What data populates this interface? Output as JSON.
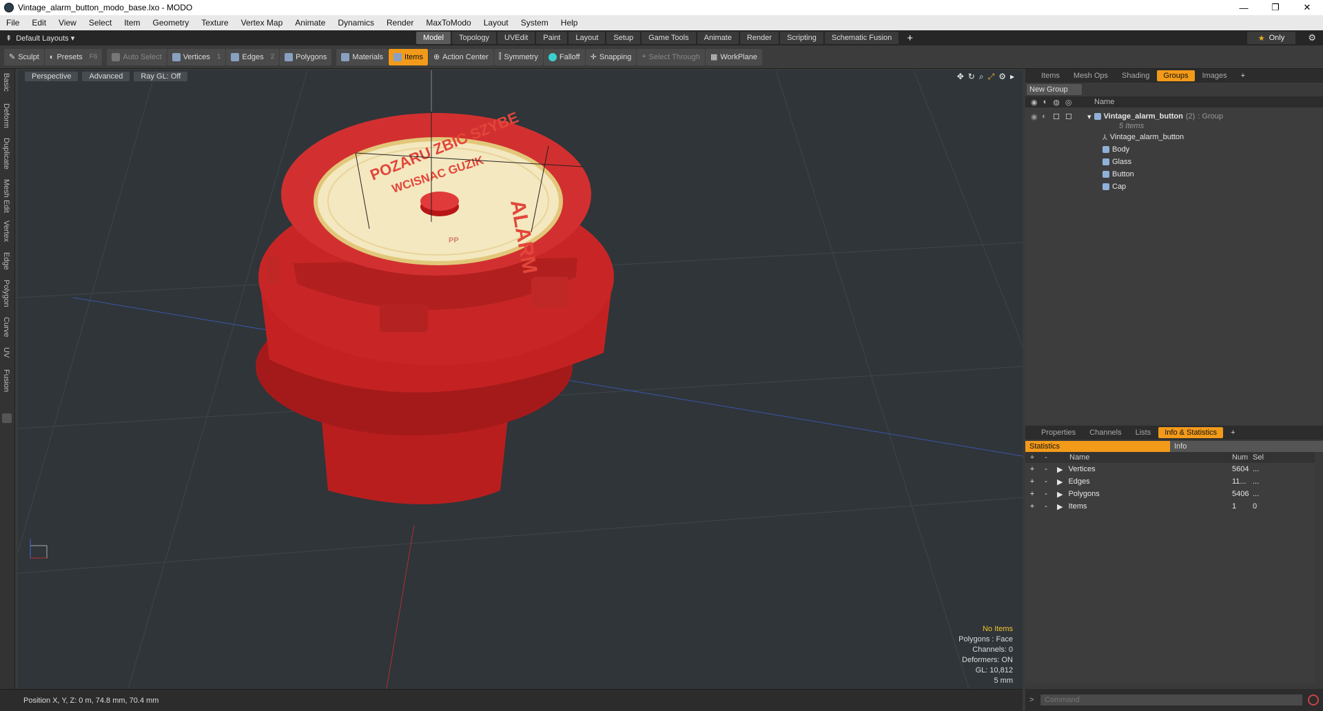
{
  "window": {
    "title": "Vintage_alarm_button_modo_base.lxo - MODO"
  },
  "menu": [
    "File",
    "Edit",
    "View",
    "Select",
    "Item",
    "Geometry",
    "Texture",
    "Vertex Map",
    "Animate",
    "Dynamics",
    "Render",
    "MaxToModo",
    "Layout",
    "System",
    "Help"
  ],
  "layouts": {
    "label": "Default Layouts ▾",
    "tabs": [
      "Model",
      "Topology",
      "UVEdit",
      "Paint",
      "Layout",
      "Setup",
      "Game Tools",
      "Animate",
      "Render",
      "Scripting",
      "Schematic Fusion"
    ],
    "active": "Model",
    "only": "Only"
  },
  "toolbar": {
    "sculpt": "Sculpt",
    "presets": "Presets",
    "presets_key": "F6",
    "auto_select": "Auto Select",
    "vertices": "Vertices",
    "vertices_key": "1",
    "edges": "Edges",
    "edges_key": "2",
    "polygons": "Polygons",
    "materials": "Materials",
    "items": "Items",
    "action_center": "Action Center",
    "symmetry": "Symmetry",
    "falloff": "Falloff",
    "snapping": "Snapping",
    "select_through": "Select Through",
    "workplane": "WorkPlane"
  },
  "left_tabs": [
    "Basic",
    "Deform",
    "Duplicate",
    "Mesh Edit",
    "Vertex",
    "Edge",
    "Polygon",
    "Curve",
    "UV",
    "Fusion"
  ],
  "viewport": {
    "mode": "Perspective",
    "advanced": "Advanced",
    "raygl": "Ray GL: Off",
    "stats": {
      "selection": "No Items",
      "polygons": "Polygons : Face",
      "channels": "Channels: 0",
      "deformers": "Deformers: ON",
      "gl": "GL: 10,812",
      "unit": "5 mm"
    },
    "label_text": {
      "line1": "POZARU ZBIC SZYBE",
      "line2": "WCISNAC GUZIK",
      "alarm": "ALARM",
      "pp": "PP"
    }
  },
  "status": {
    "position": "Position X, Y, Z:  0 m, 74.8 mm, 70.4 mm"
  },
  "items_panel": {
    "tabs": [
      "Items",
      "Mesh Ops",
      "Shading",
      "Groups",
      "Images"
    ],
    "active": "Groups",
    "new_group": "New Group",
    "name_header": "Name",
    "group": {
      "name": "Vintage_alarm_button",
      "count": "(2)",
      "type": ": Group",
      "sub": "5 Items"
    },
    "children": [
      "Vintage_alarm_button",
      "Body",
      "Glass",
      "Button",
      "Cap"
    ]
  },
  "info_panel": {
    "tabs": [
      "Properties",
      "Channels",
      "Lists",
      "Info & Statistics"
    ],
    "active": "Info & Statistics",
    "statistics": "Statistics",
    "info": "Info",
    "headers": {
      "name": "Name",
      "num": "Num",
      "sel": "Sel"
    },
    "rows": [
      {
        "name": "Vertices",
        "num": "5604",
        "sel": "..."
      },
      {
        "name": "Edges",
        "num": "11...",
        "sel": "..."
      },
      {
        "name": "Polygons",
        "num": "5406",
        "sel": "..."
      },
      {
        "name": "Items",
        "num": "1",
        "sel": "0"
      }
    ]
  },
  "command": {
    "placeholder": "Command"
  }
}
